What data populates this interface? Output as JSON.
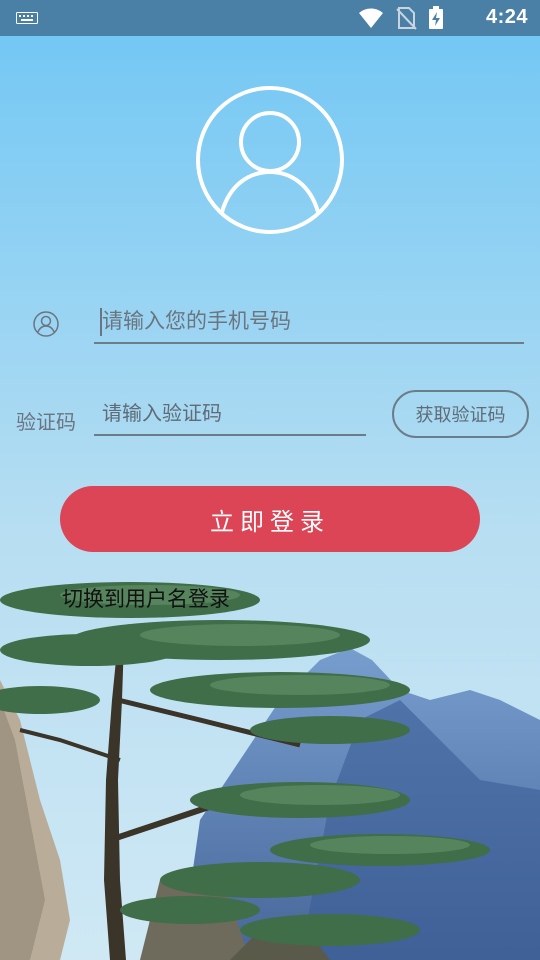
{
  "status_bar": {
    "time": "4:24",
    "icons": [
      "keyboard-icon",
      "wifi-icon",
      "no-sim-icon",
      "battery-charging-icon"
    ]
  },
  "login": {
    "phone_placeholder": "请输入您的手机号码",
    "code_label": "验证码",
    "code_placeholder": "请输入验证码",
    "get_code_label": "获取验证码",
    "submit_label": "立即登录",
    "switch_label": "切换到用户名登录"
  },
  "colors": {
    "sky_top": "#6fc6f4",
    "sky_bottom": "#cde9f5",
    "primary_button": "#db4556",
    "status_bar": "#4a7fa6"
  }
}
